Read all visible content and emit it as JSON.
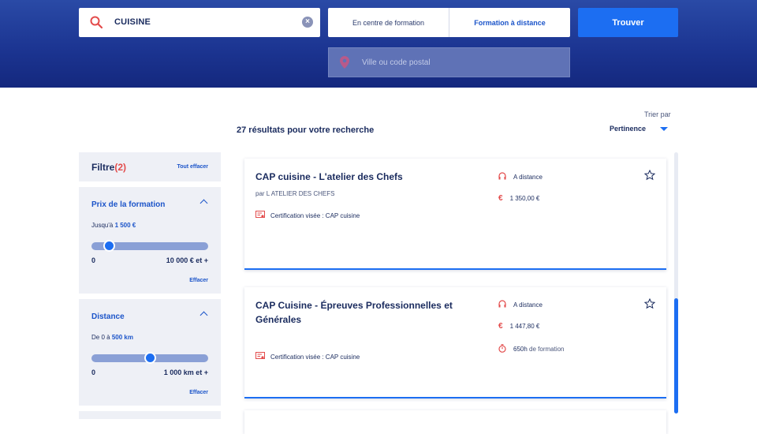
{
  "search": {
    "value": "CUISINE"
  },
  "modes": [
    "En centre de formation",
    "Formation à distance"
  ],
  "find_label": "Trouver",
  "location": {
    "placeholder": "Ville ou code postal"
  },
  "results": {
    "count_text": "27 résultats pour votre recherche"
  },
  "sort": {
    "label": "Trier par",
    "value": "Pertinence"
  },
  "filters": {
    "title": "Filtre",
    "count": "(2)",
    "clear_all": "Tout effacer",
    "price": {
      "title": "Prix de la formation",
      "sub_prefix": "Jusqu'à",
      "sub_value": "1 500 €",
      "min": "0",
      "max": "10 000 € et +",
      "slider_fraction": 0.15,
      "erase": "Effacer"
    },
    "distance": {
      "title": "Distance",
      "sub_prefix": "De 0 à",
      "sub_value": "500 km",
      "min": "0",
      "max": "1 000 km et +",
      "slider_fraction": 0.5,
      "erase": "Effacer"
    }
  },
  "cards": [
    {
      "title": "CAP cuisine - L'atelier des Chefs",
      "by": "par L ATELIER DES CHEFS",
      "cert": "Certification visée : CAP cuisine",
      "mode": "A distance",
      "price": "1 350,00 €"
    },
    {
      "title": "CAP Cuisine - Épreuves Professionnelles et Générales",
      "cert": "Certification visée : CAP cuisine",
      "mode": "A distance",
      "price": "1 447,80 €",
      "duration": "650h",
      "duration_suffix": "de formation"
    }
  ],
  "colors": {
    "header": "#1c3592",
    "accent": "#1c6ef2",
    "icon_red": "#e34b4b"
  },
  "icons": [
    "search-icon",
    "clear-icon",
    "location-pin-icon",
    "headphones-icon",
    "euro-icon",
    "timer-icon",
    "certificate-icon",
    "star-icon",
    "chevron-up-icon",
    "caret-down-icon"
  ]
}
